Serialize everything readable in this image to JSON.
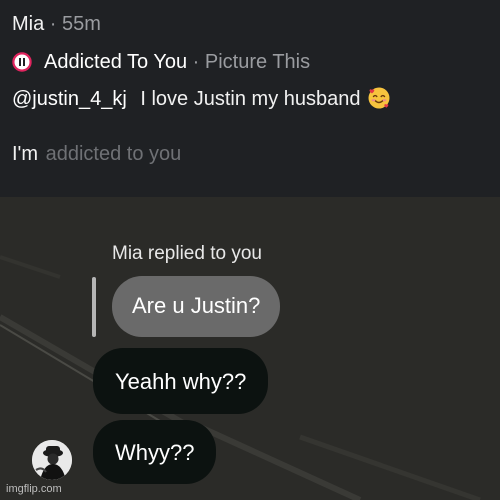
{
  "story": {
    "user": "Mia",
    "separator": " · ",
    "time_ago": "55m",
    "music": {
      "state_icon": "pause-icon",
      "song": "Addicted To You",
      "separator": " · ",
      "artist": "Picture This"
    },
    "mention": "@justin_4_kj",
    "caption": "I love Justin my husband",
    "caption_emoji_icon": "smiling-face-with-hearts-icon",
    "lyric": {
      "sung": "I'm",
      "upcoming": "addicted to you"
    }
  },
  "chat": {
    "replied_label": "Mia replied to you",
    "quoted_message": "Are u Justin?",
    "messages": [
      {
        "text": "Yeahh why??"
      },
      {
        "text": "Whyy??"
      }
    ],
    "avatar_icon": "profile-avatar-icon"
  },
  "watermark": "imgflip.com",
  "colors": {
    "header_bg": "#1f2124",
    "chat_bg": "#2b2b28",
    "quoted_bubble": "#6a6a6a",
    "message_bubble": "#0c1210",
    "dim_lyric": "#6f7175",
    "pause_ring": "#e0245e"
  }
}
